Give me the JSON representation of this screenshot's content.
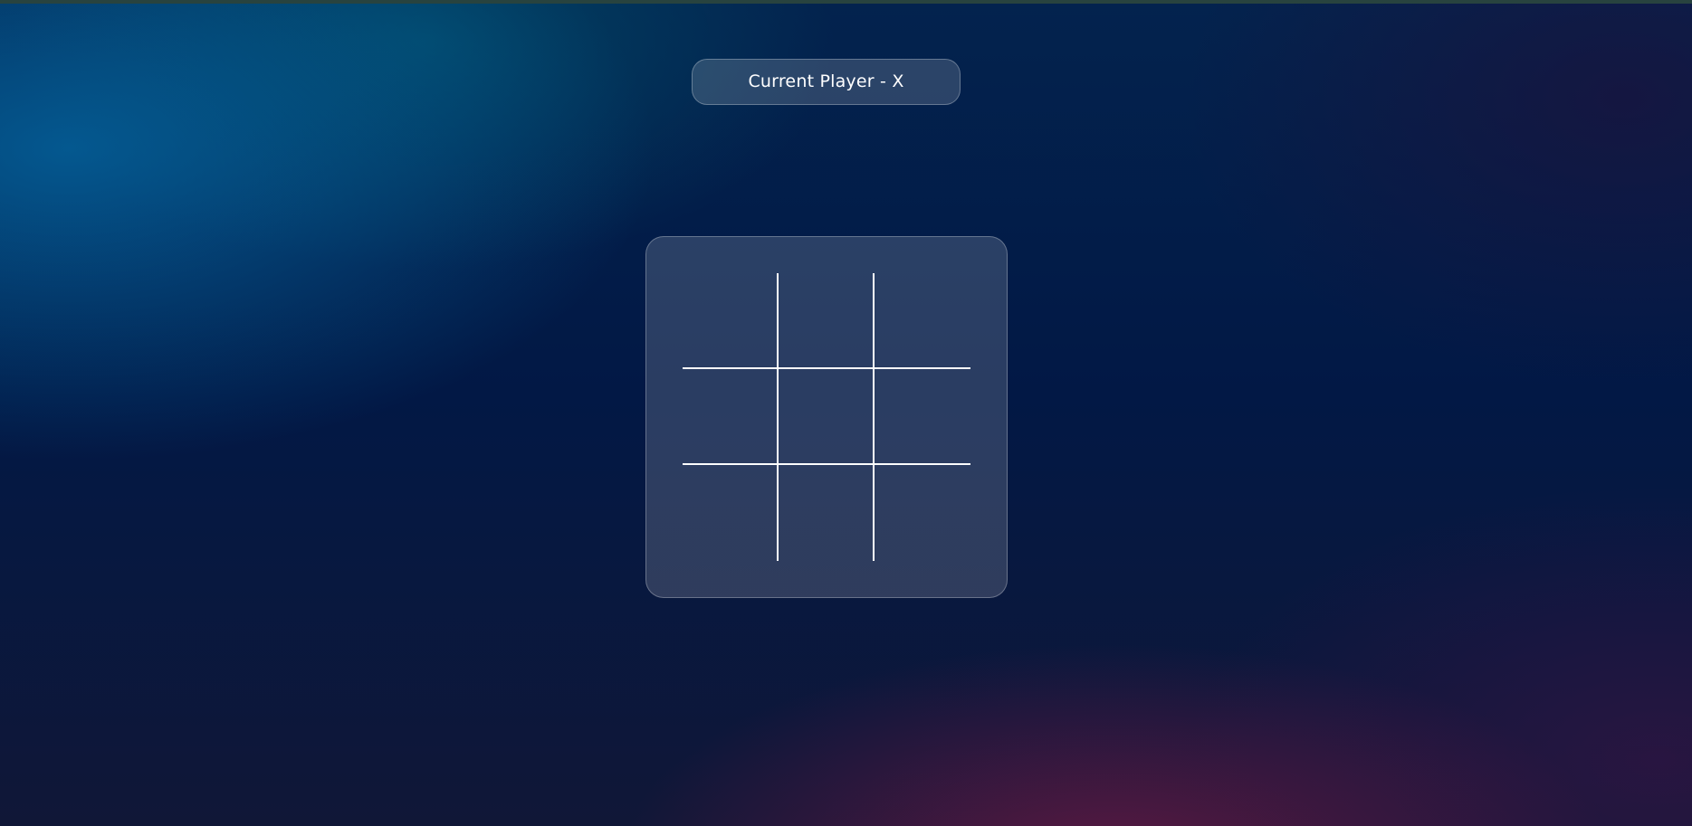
{
  "status": {
    "current_player_text": "Current Player - X"
  },
  "board": {
    "cells": [
      "",
      "",
      "",
      "",
      "",
      "",
      "",
      "",
      ""
    ]
  }
}
